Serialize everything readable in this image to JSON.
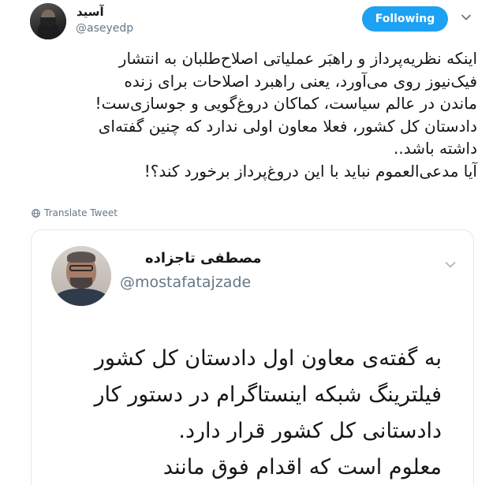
{
  "author": {
    "display_name": "آسید",
    "handle": "@aseyedp",
    "avatar_icon": "profile-photo"
  },
  "follow_button": {
    "label": "Following",
    "color": "#1da1f2"
  },
  "menu_icon": "chevron-down-icon",
  "tweet": {
    "lines": [
      "اینکه نظریه‌پرداز و راهبَر عملیاتی اصلاح‌طلبان به انتشار",
      "فیک‌نیوز روی می‌آورد، یعنی راهبرد اصلاحات برای زنده",
      "ماندن در عالم سیاست، کماکان دروغ‌گویی و جوسازی‌ست!",
      "دادستان کل کشور، فعلا معاون اولی ندارد که چنین گفته‌ای",
      "داشته باشد..",
      "آیا مدعی‌العموم نباید با این دروغ‌پرداز برخورد کند؟!"
    ]
  },
  "translate": {
    "label": "Translate Tweet",
    "icon": "globe-icon"
  },
  "quoted_tweet": {
    "display_name": "مصطفی تاجزاده",
    "handle": "@mostafatajzade",
    "body_lines": [
      "به گفته‌ی معاون اول دادستان کل کشور",
      "فیلترینگ شبکه اینستاگرام در دستور کار",
      "دادستانی کل کشور قرار دارد.",
      "معلوم است که اقدام فوق مانند"
    ]
  }
}
